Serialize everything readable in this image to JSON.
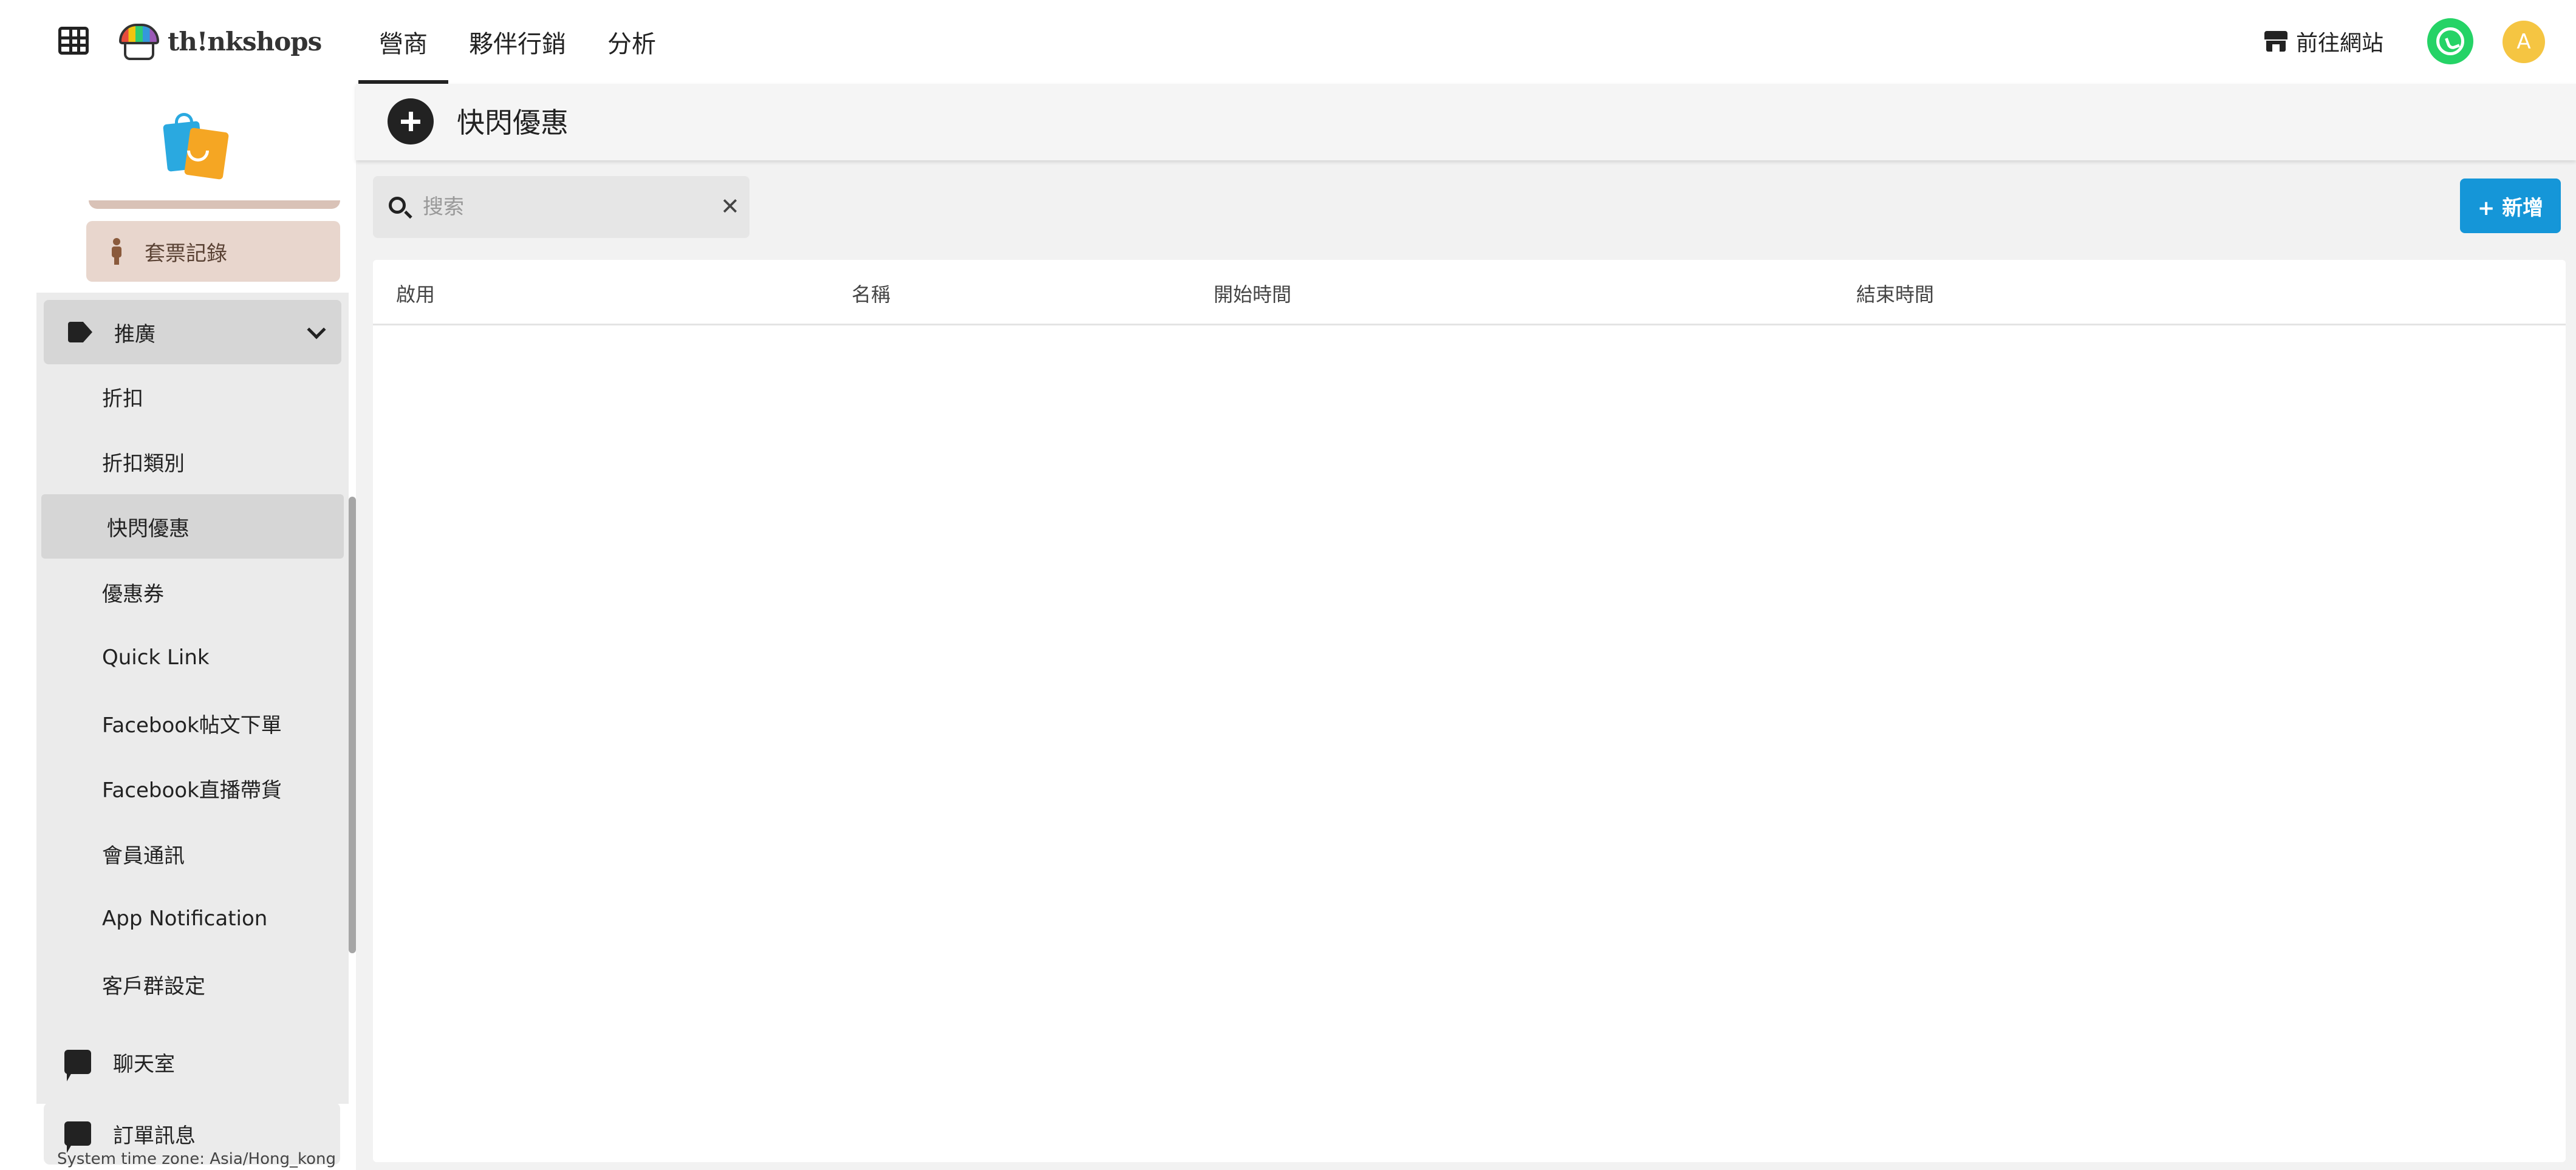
{
  "header": {
    "logo_text": "th!nkshops",
    "tabs": [
      {
        "label": "營商",
        "active": true
      },
      {
        "label": "夥伴行銷",
        "active": false
      },
      {
        "label": "分析",
        "active": false
      }
    ],
    "goto_site_label": "前往網站",
    "avatar_initial": "A"
  },
  "sidebar": {
    "ticket_record_label": "套票記錄",
    "promo_group": {
      "label": "推廣",
      "items": [
        {
          "label": "折扣"
        },
        {
          "label": "折扣類別"
        },
        {
          "label": "快閃優惠",
          "active": true
        },
        {
          "label": "優惠券"
        },
        {
          "label": "Quick Link"
        },
        {
          "label": "Facebook帖文下單"
        },
        {
          "label": "Facebook直播帶貨"
        },
        {
          "label": "會員通訊"
        },
        {
          "label": "App Notification"
        },
        {
          "label": "客戶群設定"
        }
      ]
    },
    "chatroom_label": "聊天室",
    "order_msg_label": "訂單訊息",
    "timezone_text": "System time zone: Asia/Hong_kong"
  },
  "main": {
    "title": "快閃優惠",
    "search": {
      "placeholder": "搜索",
      "value": ""
    },
    "add_button_label": "+ 新增",
    "table": {
      "columns": [
        "啟用",
        "名稱",
        "開始時間",
        "結束時間"
      ],
      "rows": []
    }
  },
  "colors": {
    "accent_blue": "#1596d8",
    "whatsapp_green": "#25d366",
    "avatar_yellow": "#f5c542",
    "sidebar_group_bg": "#ebebeb",
    "ticket_bg": "#e8d6cd"
  }
}
